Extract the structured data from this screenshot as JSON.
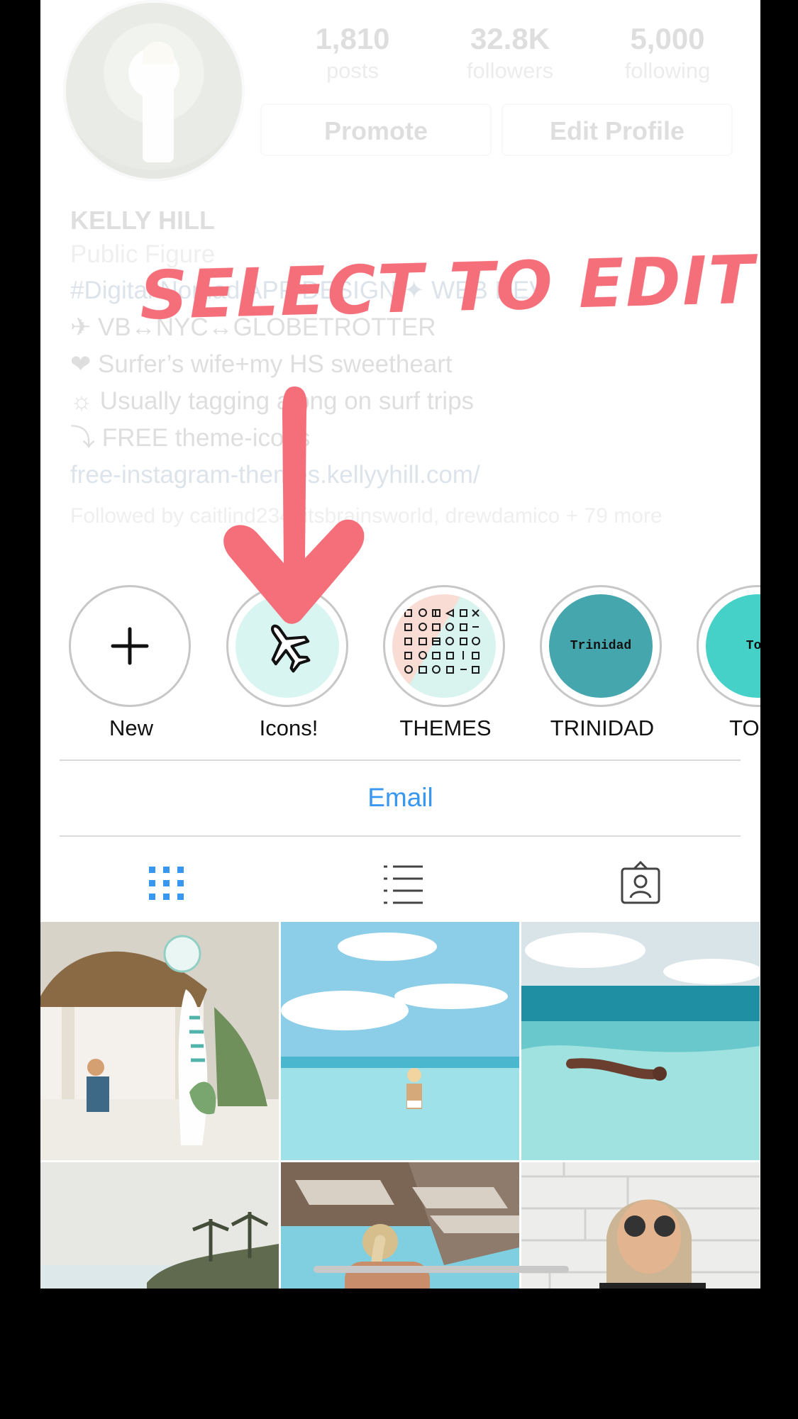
{
  "profile": {
    "stats": [
      {
        "value": "1,810",
        "label": "posts"
      },
      {
        "value": "32.8K",
        "label": "followers"
      },
      {
        "value": "5,000",
        "label": "following"
      }
    ],
    "promote_label": "Promote",
    "edit_label": "Edit Profile",
    "name": "KELLY HILL",
    "category": "Public Figure",
    "bio_lines": [
      "#Digital Nomad APP DESIGN ✦ WEB DEV",
      "✈ VB↔NYC↔GLOBETROTTER",
      "❤ Surfer’s wife+my HS sweetheart",
      "☼ Usually tagging along on surf trips",
      "⤵ FREE theme-icons"
    ],
    "link": "free-instagram-themes.kellyyhill.com/",
    "followed_by": "Followed by caitlind234, itsbrainsworld, drewdamico + 79 more"
  },
  "highlights": [
    {
      "label": "New",
      "icon": "plus-icon"
    },
    {
      "label": "Icons!",
      "icon": "airplane-icon"
    },
    {
      "label": "THEMES",
      "icon": "themes-grid-icon"
    },
    {
      "label": "TRINIDAD",
      "cover_text": "Trinidad"
    },
    {
      "label": "TOBA",
      "cover_text": "Tob"
    }
  ],
  "email_label": "Email",
  "tabs": [
    "grid-icon",
    "list-icon",
    "tagged-icon"
  ],
  "overlay": {
    "title": "SELECT TO EDIT",
    "arrow_icon": "down-arrow-icon"
  },
  "colors": {
    "accent": "#3897f0",
    "overlay": "#f56f7b",
    "teal": "#45a6ad",
    "aqua": "#45d1c7"
  }
}
